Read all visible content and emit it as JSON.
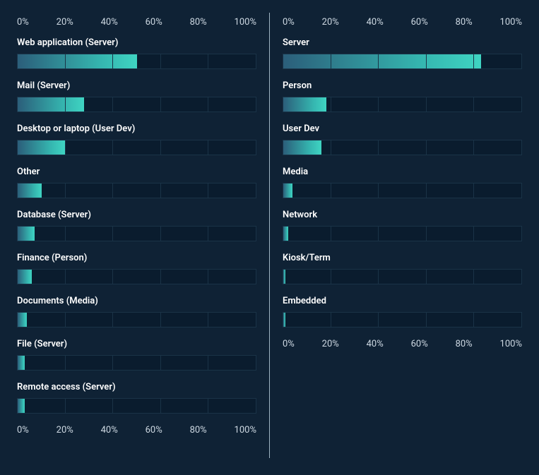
{
  "axis_ticks": [
    "0%",
    "20%",
    "40%",
    "60%",
    "80%",
    "100%"
  ],
  "chart_data": [
    {
      "type": "bar",
      "title": "",
      "xlabel": "",
      "ylabel": "",
      "xlim": [
        0,
        100
      ],
      "categories": [
        "Web application (Server)",
        "Mail (Server)",
        "Desktop or laptop (User Dev)",
        "Other",
        "Database (Server)",
        "Finance (Person)",
        "Documents (Media)",
        "File (Server)",
        "Remote access (Server)"
      ],
      "values": [
        50,
        28,
        20,
        10,
        7,
        6,
        4,
        3,
        3
      ]
    },
    {
      "type": "bar",
      "title": "",
      "xlabel": "",
      "ylabel": "",
      "xlim": [
        0,
        100
      ],
      "categories": [
        "Server",
        "Person",
        "User Dev",
        "Media",
        "Network",
        "Kiosk/Term",
        "Embedded"
      ],
      "values": [
        83,
        18,
        16,
        4,
        2,
        1,
        1
      ]
    }
  ]
}
